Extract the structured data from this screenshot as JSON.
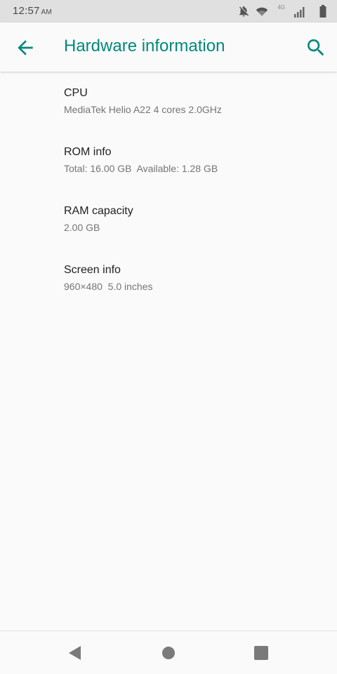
{
  "status_bar": {
    "time": "12:57",
    "ampm": "AM",
    "network_label": "4G",
    "icons": [
      "notifications-off-icon",
      "wifi-icon",
      "signal-icon",
      "battery-icon"
    ]
  },
  "app_bar": {
    "title": "Hardware information",
    "back_icon": "arrow-back-icon",
    "search_icon": "search-icon",
    "accent_color": "#00897b"
  },
  "items": [
    {
      "title": "CPU",
      "summary": "MediaTek Helio A22 4 cores 2.0GHz"
    },
    {
      "title": "ROM info",
      "summary": "Total: 16.00 GB  Available: 1.28 GB"
    },
    {
      "title": "RAM capacity",
      "summary": "2.00 GB"
    },
    {
      "title": "Screen info",
      "summary": "960×480  5.0 inches"
    }
  ],
  "nav_bar": {
    "icons": [
      "back-triangle-icon",
      "home-circle-icon",
      "recents-square-icon"
    ]
  }
}
